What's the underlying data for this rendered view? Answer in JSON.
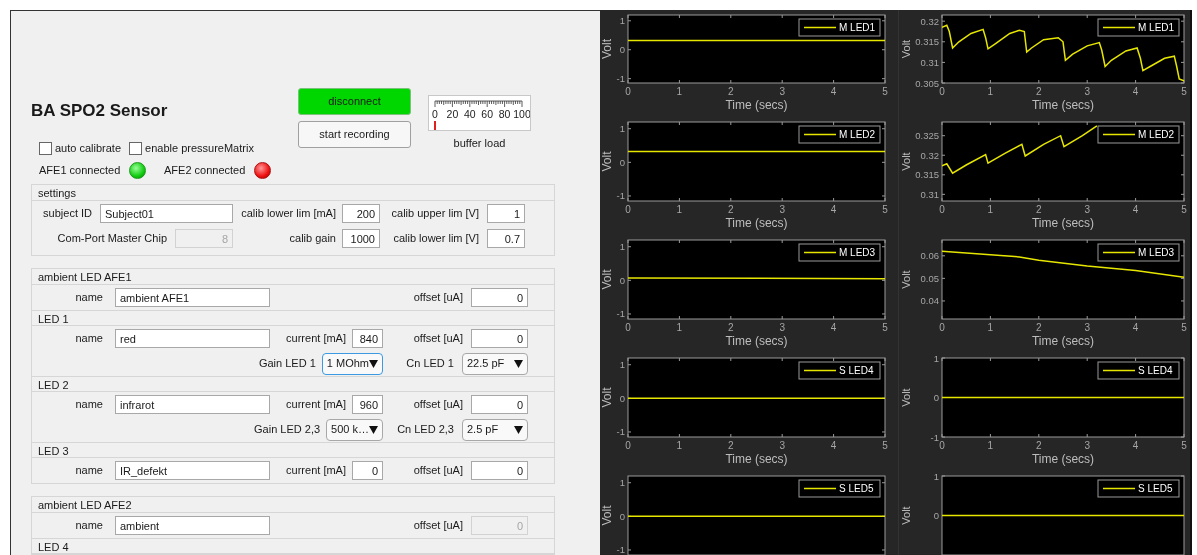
{
  "app_title": "BA SPO2 Sensor",
  "buttons": [
    {
      "label": "disconnect",
      "kind": "connected"
    },
    {
      "label": "start recording",
      "kind": "plain"
    }
  ],
  "gauge": {
    "label": "buffer load",
    "tick_labels": [
      "0",
      "20",
      "40",
      "60",
      "80",
      "100"
    ],
    "level": 0
  },
  "checkboxes": [
    {
      "label": "auto calibrate",
      "checked": false
    },
    {
      "label": "enable pressureMatrix",
      "checked": false
    }
  ],
  "indicators": [
    {
      "label": "AFE1 connected",
      "on": true
    },
    {
      "label": "AFE2 connected",
      "on": false
    }
  ],
  "settings": {
    "title": "settings",
    "rows": [
      [
        {
          "kind": "text",
          "label": "subject ID",
          "value": "Subject01",
          "disabled": false
        },
        {
          "kind": "number",
          "label": "calib lower lim [mA]",
          "value": "200",
          "disabled": false
        },
        {
          "kind": "number",
          "label": "calib upper lim [V]",
          "value": "1",
          "disabled": false
        }
      ],
      [
        {
          "kind": "number",
          "label": "Com-Port Master Chip",
          "value": "8",
          "disabled": true
        },
        {
          "kind": "number",
          "label": "calib gain",
          "value": "1000",
          "disabled": false
        },
        {
          "kind": "number",
          "label": "calib lower lim [V]",
          "value": "0.7",
          "disabled": false
        }
      ]
    ]
  },
  "led_panels": [
    {
      "title": "ambient LED AFE1",
      "rows": [
        [
          {
            "kind": "text",
            "label": "name",
            "value": "ambient AFE1",
            "disabled": false
          },
          "",
          {
            "kind": "number",
            "label": "offset [uA]",
            "value": "0",
            "disabled": false
          }
        ]
      ],
      "sections": [
        {
          "heading": "LED 1",
          "rows": [
            [
              {
                "kind": "text",
                "label": "name",
                "value": "red",
                "disabled": false
              },
              {
                "kind": "number",
                "label": "current [mA]",
                "value": "840",
                "disabled": false
              },
              {
                "kind": "number",
                "label": "offset [uA]",
                "value": "0",
                "disabled": false
              }
            ],
            [
              "",
              {
                "kind": "dropdown",
                "label": "Gain LED 1",
                "value": "1 MOhm",
                "disabled": false,
                "focused": true
              },
              {
                "kind": "dropdown",
                "label": "Cn LED 1",
                "value": "22.5 pF",
                "disabled": false,
                "focused": false
              }
            ]
          ]
        },
        {
          "heading": "LED 2",
          "rows": [
            [
              {
                "kind": "text",
                "label": "name",
                "value": "infrarot",
                "disabled": false
              },
              {
                "kind": "number",
                "label": "current [mA]",
                "value": "960",
                "disabled": false
              },
              {
                "kind": "number",
                "label": "offset [uA]",
                "value": "0",
                "disabled": false
              }
            ],
            [
              "",
              {
                "kind": "dropdown",
                "label": "Gain LED 2,3",
                "value": "500 k…",
                "disabled": false,
                "focused": false
              },
              {
                "kind": "dropdown",
                "label": "Cn LED 2,3",
                "value": "2.5 pF",
                "disabled": false,
                "focused": false
              }
            ]
          ]
        },
        {
          "heading": "LED 3",
          "rows": [
            [
              {
                "kind": "text",
                "label": "name",
                "value": "IR_defekt",
                "disabled": false
              },
              {
                "kind": "number",
                "label": "current [mA]",
                "value": "0",
                "disabled": false
              },
              {
                "kind": "number",
                "label": "offset [uA]",
                "value": "0",
                "disabled": false
              }
            ]
          ]
        }
      ]
    },
    {
      "title": "ambient LED AFE2",
      "rows": [
        [
          {
            "kind": "text",
            "label": "name",
            "value": "ambient",
            "disabled": false
          },
          "",
          {
            "kind": "number",
            "label": "offset [uA]",
            "value": "0",
            "disabled": true
          }
        ]
      ],
      "sections": [
        {
          "heading": "LED 4"
        }
      ]
    }
  ],
  "plot_columns": [
    {
      "plots": [
        {
          "chart_data": {
            "type": "line",
            "xlabel": "Time (secs)",
            "ylabel": "Volt",
            "x": [
              0,
              5
            ],
            "series": [
              {
                "name": "M LED1",
                "color": "#e6e600",
                "values": [
                  0.32,
                  0.32
                ]
              }
            ],
            "xlim": [
              0,
              5
            ],
            "ylim": [
              -1.15,
              1.2
            ],
            "xticks": [
              0,
              1,
              2,
              3,
              4,
              5
            ],
            "yticks": [
              -1,
              0,
              1
            ]
          }
        },
        {
          "chart_data": {
            "type": "line",
            "xlabel": "Time (secs)",
            "ylabel": "Volt",
            "x": [
              0,
              5
            ],
            "series": [
              {
                "name": "M LED2",
                "color": "#e6e600",
                "values": [
                  0.32,
                  0.32
                ]
              }
            ],
            "xlim": [
              0,
              5
            ],
            "ylim": [
              -1.15,
              1.2
            ],
            "xticks": [
              0,
              1,
              2,
              3,
              4,
              5
            ],
            "yticks": [
              -1,
              0,
              1
            ]
          }
        },
        {
          "chart_data": {
            "type": "line",
            "xlabel": "Time (secs)",
            "ylabel": "Volt",
            "x": [
              0,
              5
            ],
            "series": [
              {
                "name": "M LED3",
                "color": "#e6e600",
                "values": [
                  0.07,
                  0.05
                ]
              }
            ],
            "xlim": [
              0,
              5
            ],
            "ylim": [
              -1.15,
              1.2
            ],
            "xticks": [
              0,
              1,
              2,
              3,
              4,
              5
            ],
            "yticks": [
              -1,
              0,
              1
            ]
          }
        },
        {
          "chart_data": {
            "type": "line",
            "xlabel": "Time (secs)",
            "ylabel": "Volt",
            "x": [
              0,
              5
            ],
            "series": [
              {
                "name": "S LED4",
                "color": "#e6e600",
                "values": [
                  0,
                  0
                ]
              }
            ],
            "xlim": [
              0,
              5
            ],
            "ylim": [
              -1.15,
              1.2
            ],
            "xticks": [
              0,
              1,
              2,
              3,
              4,
              5
            ],
            "yticks": [
              -1,
              0,
              1
            ]
          }
        },
        {
          "chart_data": {
            "type": "line",
            "ylabel": "Volt",
            "x": [
              0,
              5
            ],
            "series": [
              {
                "name": "S LED5",
                "color": "#e6e600",
                "values": [
                  0,
                  0
                ]
              }
            ],
            "xlim": [
              0,
              5
            ],
            "ylim": [
              -1.15,
              1.2
            ],
            "yticks": [
              -1,
              0,
              1
            ]
          }
        }
      ]
    },
    {
      "plots": [
        {
          "chart_data": {
            "type": "line",
            "xlabel": "Time (secs)",
            "ylabel": "Volt",
            "x": [
              0,
              0.1,
              0.15,
              0.22,
              0.35,
              0.6,
              0.85,
              0.9,
              0.95,
              1.1,
              1.4,
              1.6,
              1.7,
              1.75,
              1.85,
              2.1,
              2.4,
              2.5,
              2.55,
              2.7,
              3.0,
              3.25,
              3.3,
              3.37,
              3.5,
              3.8,
              4.03,
              4.1,
              4.15,
              4.3,
              4.6,
              4.8,
              4.85,
              4.9,
              5
            ],
            "series": [
              {
                "name": "M LED1",
                "color": "#e6e600",
                "values": [
                  0.3185,
                  0.319,
                  0.3175,
                  0.3135,
                  0.315,
                  0.317,
                  0.318,
                  0.316,
                  0.3133,
                  0.3145,
                  0.317,
                  0.3178,
                  0.3175,
                  0.3125,
                  0.3135,
                  0.3155,
                  0.316,
                  0.315,
                  0.3105,
                  0.312,
                  0.314,
                  0.3148,
                  0.313,
                  0.309,
                  0.3105,
                  0.3128,
                  0.3135,
                  0.311,
                  0.308,
                  0.309,
                  0.311,
                  0.3115,
                  0.309,
                  0.306,
                  0.3055
                ]
              }
            ],
            "xlim": [
              0,
              5
            ],
            "ylim": [
              0.305,
              0.3215
            ],
            "xticks": [
              0,
              1,
              2,
              3,
              4,
              5
            ],
            "yticks": [
              0.305,
              0.31,
              0.315,
              0.32
            ]
          }
        },
        {
          "chart_data": {
            "type": "line",
            "xlabel": "Time (secs)",
            "ylabel": "Volt",
            "x": [
              0,
              0.1,
              0.22,
              0.5,
              0.9,
              0.95,
              1.3,
              1.65,
              1.72,
              2.1,
              2.45,
              2.52,
              2.9,
              3.2
            ],
            "series": [
              {
                "name": "M LED2",
                "color": "#e6e600",
                "values": [
                  0.3173,
                  0.3178,
                  0.3154,
                  0.3175,
                  0.3202,
                  0.318,
                  0.3205,
                  0.3228,
                  0.3198,
                  0.3228,
                  0.325,
                  0.3222,
                  0.325,
                  0.3275
                ]
              }
            ],
            "xlim": [
              0,
              5
            ],
            "ylim": [
              0.3083,
              0.3285
            ],
            "xticks": [
              0,
              1,
              2,
              3,
              4,
              5
            ],
            "yticks": [
              0.31,
              0.315,
              0.32,
              0.325
            ]
          }
        },
        {
          "chart_data": {
            "type": "line",
            "xlabel": "Time (secs)",
            "ylabel": "Volt",
            "x": [
              0,
              1,
              1.6,
              2,
              3,
              4,
              5
            ],
            "series": [
              {
                "name": "M LED3",
                "color": "#e6e600",
                "values": [
                  0.062,
                  0.0605,
                  0.0595,
                  0.058,
                  0.0555,
                  0.0535,
                  0.0505
                ]
              }
            ],
            "xlim": [
              0,
              5
            ],
            "ylim": [
              0.032,
              0.067
            ],
            "xticks": [
              0,
              1,
              2,
              3,
              4,
              5
            ],
            "yticks": [
              0.04,
              0.05,
              0.06
            ]
          }
        },
        {
          "chart_data": {
            "type": "line",
            "xlabel": "Time (secs)",
            "ylabel": "Volt",
            "x": [
              0,
              5
            ],
            "series": [
              {
                "name": "S LED4",
                "color": "#e6e600",
                "values": [
                  0,
                  0
                ]
              }
            ],
            "xlim": [
              0,
              5
            ],
            "ylim": [
              -1,
              1
            ],
            "xticks": [
              0,
              1,
              2,
              3,
              4,
              5
            ],
            "yticks": [
              -1,
              0,
              1
            ]
          }
        },
        {
          "chart_data": {
            "type": "line",
            "ylabel": "Volt",
            "x": [
              0,
              5
            ],
            "series": [
              {
                "name": "S LED5",
                "color": "#e6e600",
                "values": [
                  0,
                  0
                ]
              }
            ],
            "xlim": [
              0,
              5
            ],
            "ylim": [
              -1,
              1
            ],
            "yticks": [
              0,
              1
            ]
          }
        }
      ]
    }
  ]
}
